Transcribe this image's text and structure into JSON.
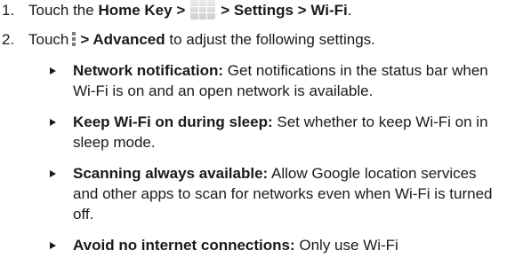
{
  "steps": [
    {
      "number": "1.",
      "prefix": "Touch the ",
      "bold1": "Home Key >",
      "icon": "apps-grid-icon",
      "bold2": "> Settings > Wi-Fi",
      "suffix": "."
    },
    {
      "number": "2.",
      "prefix": "Touch",
      "icon": "menu-dots-icon",
      "bold1": "> Advanced",
      "suffix": " to adjust the following settings."
    }
  ],
  "settings": [
    {
      "title": "Network notification:",
      "description": " Get notifications in the status bar when Wi-Fi is on and an open network is available."
    },
    {
      "title": "Keep Wi-Fi on during sleep:",
      "description": " Set whether to keep Wi-Fi on in sleep mode."
    },
    {
      "title": "Scanning always available:",
      "description": " Allow Google location services and other apps to scan for networks even when Wi-Fi is turned off."
    },
    {
      "title": "Avoid no internet connections:",
      "description": " Only use Wi-Fi"
    }
  ]
}
